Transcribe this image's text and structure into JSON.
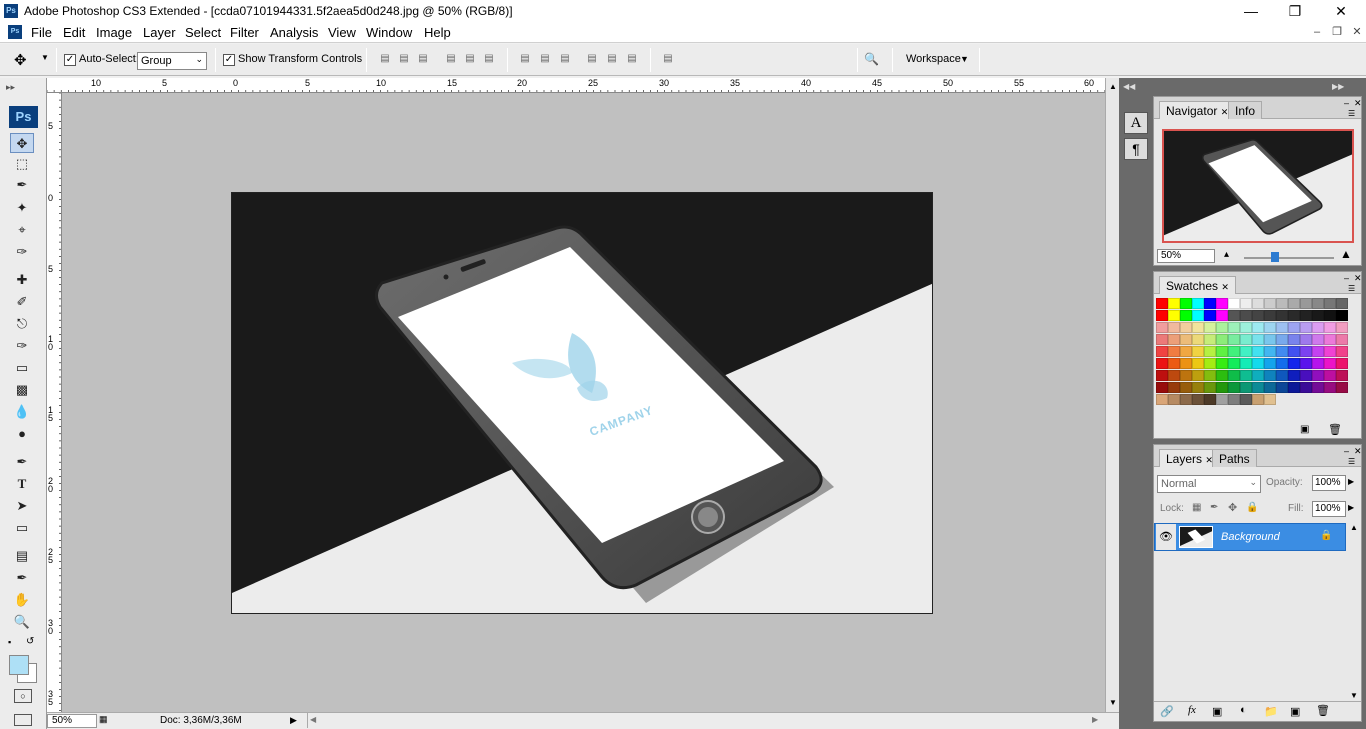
{
  "window": {
    "title": "Adobe Photoshop CS3 Extended - [ccda07101944331.5f2aea5d0d248.jpg @ 50% (RGB/8)]",
    "app_icon": "Ps",
    "controls": [
      "minimize-icon",
      "restore-icon",
      "close-icon"
    ]
  },
  "menu": {
    "items": [
      "File",
      "Edit",
      "Image",
      "Layer",
      "Select",
      "Filter",
      "Analysis",
      "View",
      "Window",
      "Help"
    ]
  },
  "options": {
    "auto_select_label": "Auto-Select:",
    "auto_select_checked": true,
    "auto_select_value": "Group",
    "show_transform_label": "Show Transform Controls",
    "show_transform_checked": true,
    "workspace_label": "Workspace"
  },
  "toolbox": {
    "logo": "Ps",
    "tools": [
      "move-tool-icon",
      "marquee-tool-icon",
      "lasso-tool-icon",
      "magic-wand-icon",
      "crop-tool-icon",
      "slice-tool-icon",
      "healing-brush-icon",
      "brush-tool-icon",
      "clone-stamp-icon",
      "history-brush-icon",
      "eraser-icon",
      "gradient-tool-icon",
      "blur-tool-icon",
      "dodge-tool-icon",
      "pen-tool-icon",
      "type-tool-icon",
      "path-selection-icon",
      "shape-tool-icon",
      "notes-tool-icon",
      "eyedropper-icon",
      "hand-tool-icon",
      "zoom-tool-icon"
    ],
    "foreground_color": "#aee0f6",
    "background_color": "#ffffff"
  },
  "rulers": {
    "horizontal_labels": [
      "10",
      "5",
      "0",
      "5",
      "10",
      "15",
      "20",
      "25",
      "30",
      "35",
      "40",
      "45",
      "50",
      "55",
      "60"
    ],
    "vertical_labels": [
      "5",
      "0",
      "5",
      "10",
      "15",
      "20",
      "25",
      "30",
      "35"
    ]
  },
  "canvas": {
    "logo_text": "CAMPANY",
    "accent_color": "#9fd3ea"
  },
  "status": {
    "zoom": "50%",
    "doc_info": "Doc: 3,36M/3,36M"
  },
  "panels": {
    "navigator": {
      "tabs": [
        "Navigator",
        "Info"
      ],
      "zoom_value": "50%"
    },
    "swatches": {
      "tab": "Swatches"
    },
    "layers": {
      "tabs": [
        "Layers",
        "Paths"
      ],
      "blend_mode": "Normal",
      "opacity_label": "Opacity:",
      "opacity_value": "100%",
      "lock_label": "Lock:",
      "fill_label": "Fill:",
      "fill_value": "100%",
      "layer_name": "Background"
    }
  }
}
